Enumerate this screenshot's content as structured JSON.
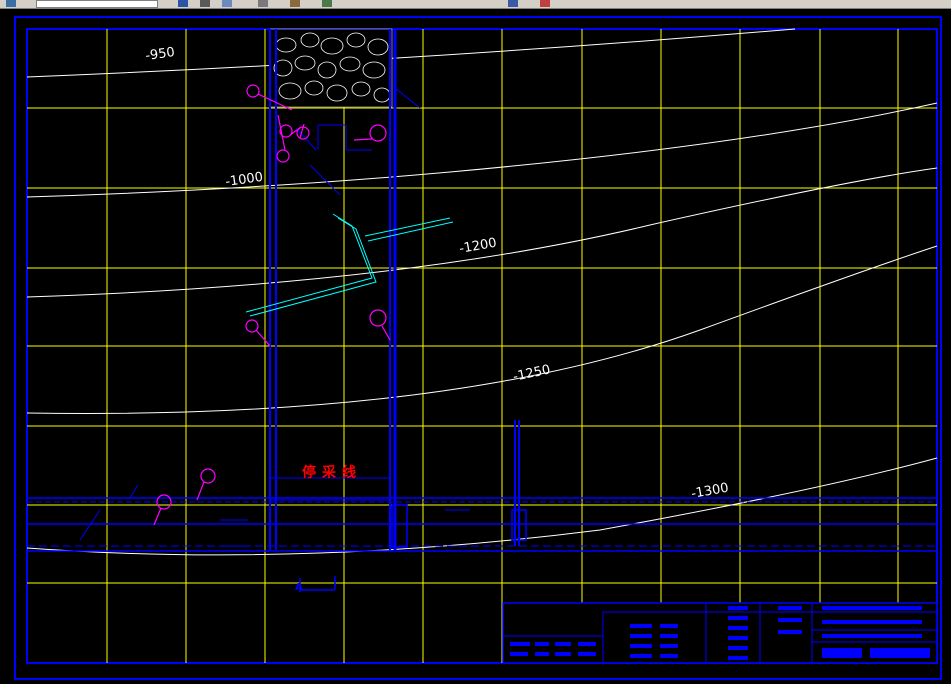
{
  "toolbar": {
    "icons": [
      "layer-icon",
      "pan-icon",
      "zoom-icon",
      "undo-icon",
      "redo-icon",
      "properties-icon",
      "match-icon",
      "help-icon",
      "close-icon"
    ]
  },
  "drawing": {
    "contour_labels": [
      "-950",
      "-1000",
      "-1200",
      "-1250",
      "-1300"
    ],
    "stop_line_label": "停采线",
    "section_marker": "A",
    "colors": {
      "background": "#000000",
      "border": "#0000ff",
      "grid": "#ffff00",
      "contour": "#ffffff",
      "roadway": "#0000ff",
      "fault": "#00ffff",
      "marker": "#ff00ff",
      "stop_line": "#ff0000"
    }
  }
}
